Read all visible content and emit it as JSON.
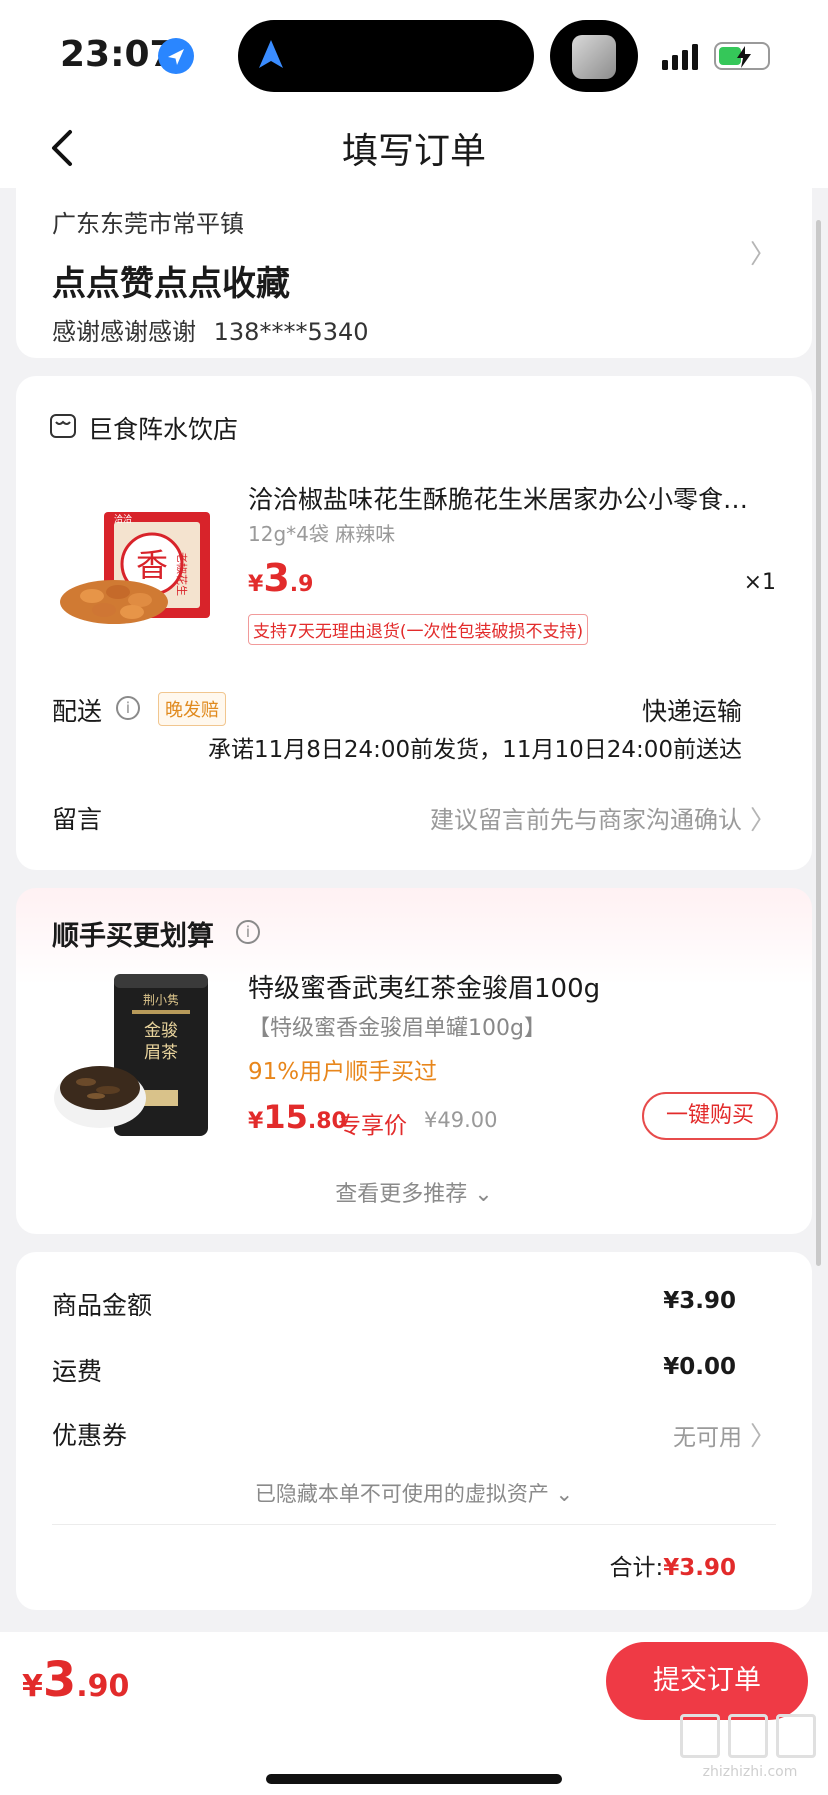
{
  "status_bar": {
    "time": "23:07"
  },
  "header": {
    "title": "填写订单"
  },
  "address": {
    "region": "广东东莞市常平镇",
    "detail": "点点赞点点收藏",
    "name": "感谢感谢感谢",
    "phone": "138****5340"
  },
  "store": {
    "name": "巨食阵水饮店",
    "product": {
      "title": "洽洽椒盐味花生酥脆花生米居家办公小零食…",
      "spec": "12g*4袋 麻辣味",
      "price_symbol": "¥",
      "price_int": "3",
      "price_dec": ".9",
      "qty": "×1",
      "refund_tag": "支持7天无理由退货(一次性包装破损不支持)"
    },
    "shipping": {
      "label": "配送",
      "info_glyph": "i",
      "late_tag": "晚发赔",
      "mode": "快递运输",
      "promise": "承诺11月8日24:00前发货，11月10日24:00前送达"
    },
    "note": {
      "label": "留言",
      "placeholder": "建议留言前先与商家沟通确认"
    }
  },
  "recommend": {
    "title": "顺手买更划算",
    "info_glyph": "i",
    "item": {
      "name": "特级蜜香武夷红茶金骏眉100g",
      "spec": "【特级蜜香金骏眉单罐100g】",
      "social": "91%用户顺手买过",
      "price_symbol": "¥",
      "price_int": "15",
      "price_dec": ".80",
      "price_label": "专享价",
      "orig_price": "¥49.00",
      "buy_button": "一键购买",
      "img_brand": "荆小隽",
      "img_name_1": "金骏",
      "img_name_2": "眉茶"
    },
    "more": "查看更多推荐 ⌄"
  },
  "summary": {
    "goods_label": "商品金额",
    "goods_value": "¥3.90",
    "freight_label": "运费",
    "freight_value": "¥0.00",
    "coupon_label": "优惠券",
    "coupon_value": "无可用",
    "hidden_assets": "已隐藏本单不可使用的虚拟资产 ⌄",
    "total_label": "合计:",
    "total_value": "¥3.90"
  },
  "bottom": {
    "price_symbol": "¥",
    "price_int": "3",
    "price_dec": ".90",
    "submit_label": "提交订单",
    "watermark": "zhizhizhi.com"
  },
  "product_img_text": {
    "brand": "洽洽",
    "seal": "香",
    "label": "老椒花生"
  },
  "colors": {
    "accent_red": "#e22b2b",
    "submit_red": "#ef3a45",
    "orange": "#e8861b",
    "background": "#f2f2f4"
  }
}
